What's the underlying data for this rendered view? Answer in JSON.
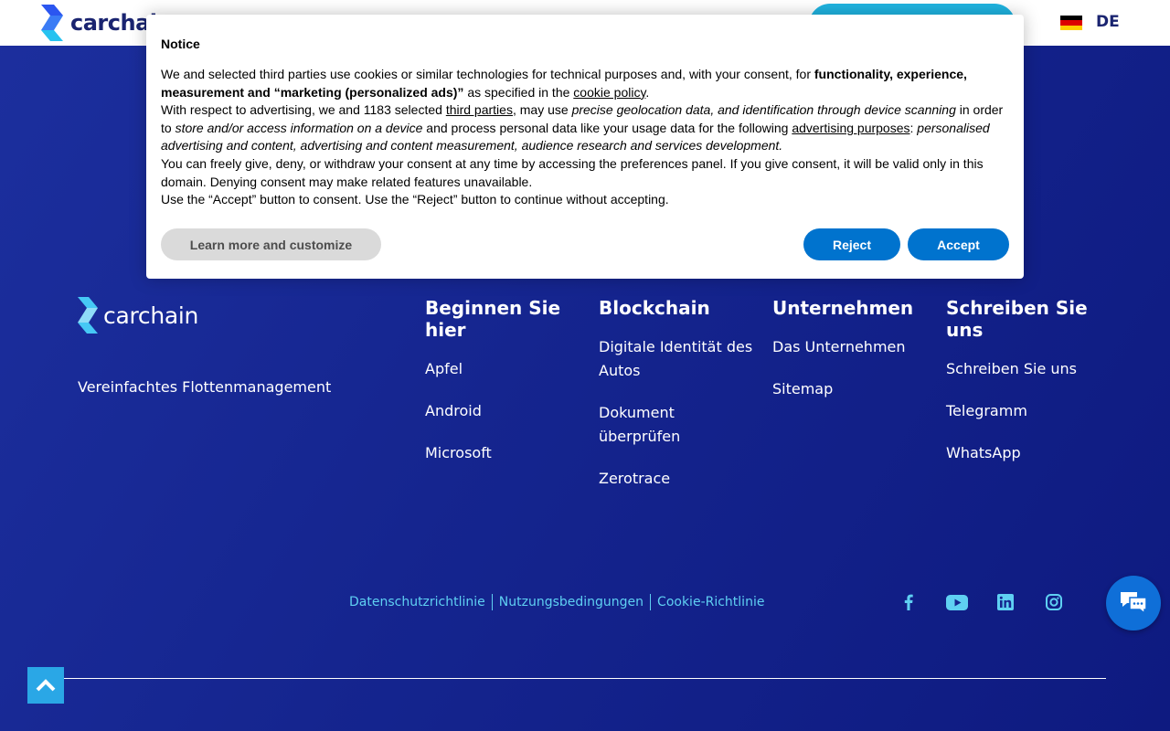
{
  "header": {
    "logo_text": "carchain",
    "language": "DE",
    "flag_colors": [
      "#000000",
      "#dd0000",
      "#ffce00"
    ]
  },
  "footer": {
    "logo_text": "carchain",
    "tagline": "Vereinfachtes Flottenmanagement",
    "columns": [
      {
        "title": "Beginnen Sie hier",
        "links": [
          "Apfel",
          "Android",
          "Microsoft"
        ]
      },
      {
        "title": "Blockchain",
        "links": [
          "Digitale Identität des Autos",
          "Dokument überprüfen",
          "Zerotrace"
        ]
      },
      {
        "title": "Unternehmen",
        "links": [
          "Das Unternehmen",
          "Sitemap"
        ]
      },
      {
        "title": "Schreiben Sie uns",
        "links": [
          "Schreiben Sie uns",
          "Telegramm",
          "WhatsApp"
        ]
      }
    ],
    "legal": [
      "Datenschutzrichtlinie",
      "Nutzungsbedingungen",
      "Cookie-Richtlinie"
    ],
    "social": [
      "facebook-icon",
      "youtube-icon",
      "linkedin-icon",
      "instagram-icon"
    ]
  },
  "notice": {
    "title": "Notice",
    "p1_a": "We and selected third parties use cookies or similar technologies for technical purposes and, with your consent, for ",
    "p1_b": "functionality, experience, measurement and “marketing (personalized ads)”",
    "p1_c": " as specified in the ",
    "p1_link": "cookie policy",
    "p1_d": ".",
    "p2_a": "With respect to advertising, we and 1183 selected ",
    "p2_link1": "third parties",
    "p2_b": ", may use ",
    "p2_c": "precise geolocation data, and identification through device scanning",
    "p2_d": " in order to ",
    "p2_e": "store and/or access information on a device",
    "p2_f": " and process personal data like your usage data for the following ",
    "p2_link2": "advertising purposes",
    "p2_g": ": ",
    "p2_h": "personalised advertising and content, advertising and content measurement, audience research and services development.",
    "p3": "You can freely give, deny, or withdraw your consent at any time by accessing the preferences panel. If you give consent, it will be valid only in this domain. Denying consent may make related features unavailable.",
    "p4": "Use the “Accept” button to consent. Use the “Reject” button to continue without accepting.",
    "learn_label": "Learn more and customize",
    "reject_label": "Reject",
    "accept_label": "Accept"
  },
  "colors": {
    "accent_cyan": "#5fd0f2",
    "button_blue": "#0073ce",
    "footer_bg": "#15258f"
  }
}
